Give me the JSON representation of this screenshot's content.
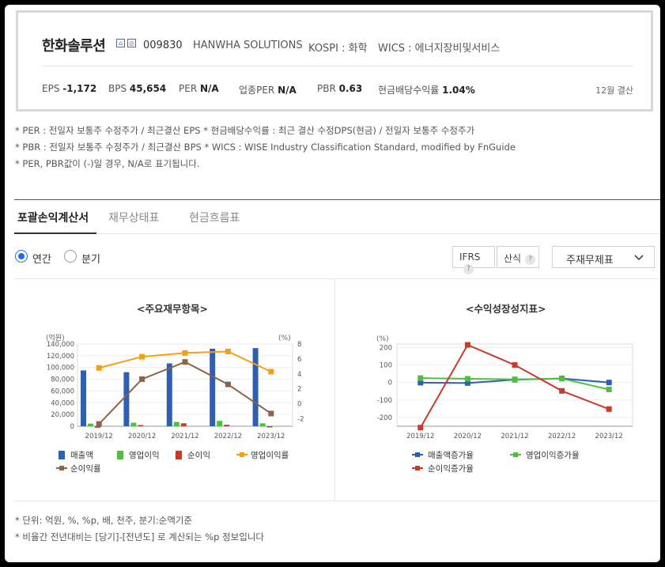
{
  "company": {
    "name": "한화솔루션",
    "code": "009830",
    "english_name": "HANWHA SOLUTIONS",
    "market": "KOSPI : 화학",
    "wics": "WICS : 에너지장비및서비스",
    "fiscal": "12월 결산"
  },
  "stats": [
    {
      "label": "EPS",
      "value": "-1,172"
    },
    {
      "label": "BPS",
      "value": "45,654"
    },
    {
      "label": "PER",
      "value": "N/A"
    },
    {
      "label": "업종PER",
      "value": "N/A"
    },
    {
      "label": "PBR",
      "value": "0.63"
    },
    {
      "label": "현금배당수익률",
      "value": "1.04%"
    }
  ],
  "notes": [
    "* PER : 전일자 보통주 수정주가 / 최근결산 EPS * 현금배당수익률 : 최근 결산 수정DPS(현금) / 전일자 보통주 수정주가",
    "* PBR : 전일자 보통주 수정주가 / 최근결산 BPS * WICS : WISE Industry Classification Standard, modified by FnGuide",
    "* PER, PBR값이 (-)일 경우, N/A로 표기됩니다."
  ],
  "tabs": [
    "포괄손익계산서",
    "재무상태표",
    "현금흐름표"
  ],
  "period": {
    "annual": "연간",
    "quarter": "분기"
  },
  "options": {
    "ifrs": "IFRS",
    "ifrs_help": "?",
    "calc": "산식",
    "calc_help": "?",
    "select": "주재무제표"
  },
  "footer": [
    "* 단위: 억원, %, %p, 배, 천주, 분기:순액기준",
    "* 비율간 전년대비는 [당기]-[전년도] 로 계산되는 %p 정보입니다"
  ],
  "chart_data": [
    {
      "type": "bar",
      "title": "<주요재무항목>",
      "categories": [
        "2019/12",
        "2020/12",
        "2021/12",
        "2022/12",
        "2023/12"
      ],
      "ylabel_left": "(억원)",
      "ylabel_right": "(%)",
      "ylim_left": [
        0,
        140000
      ],
      "yticks_left": [
        "0",
        "20,000",
        "40,000",
        "60,000",
        "80,000",
        "100,000",
        "120,000",
        "140,000"
      ],
      "ylim_right": [
        -3,
        8
      ],
      "yticks_right": [
        "-2",
        "0",
        "2",
        "4",
        "6",
        "8"
      ],
      "series": [
        {
          "name": "매출액",
          "type": "bar",
          "axis": "left",
          "color": "#2f5fb3",
          "values": [
            95000,
            92000,
            107000,
            132000,
            133000
          ]
        },
        {
          "name": "영업이익",
          "type": "bar",
          "axis": "left",
          "color": "#4fbf3f",
          "values": [
            4500,
            6000,
            7400,
            9200,
            5000
          ]
        },
        {
          "name": "순이익",
          "type": "bar",
          "axis": "left",
          "color": "#c83a2a",
          "values": [
            -2500,
            2000,
            5000,
            2500,
            -1300
          ]
        },
        {
          "name": "영업이익률",
          "type": "line",
          "axis": "right",
          "color": "#f5a011",
          "values": [
            4.8,
            6.3,
            6.8,
            7.0,
            4.3
          ]
        },
        {
          "name": "순이익률",
          "type": "line",
          "axis": "right",
          "color": "#8b6348",
          "values": [
            -2.7,
            3.3,
            5.6,
            2.6,
            -1.3
          ]
        }
      ],
      "grid": true,
      "legend": "bottom"
    },
    {
      "type": "line",
      "title": "<수익성장성지표>",
      "categories": [
        "2019/12",
        "2020/12",
        "2021/12",
        "2022/12",
        "2023/12"
      ],
      "ylabel": "(%)",
      "ylim": [
        -250,
        220
      ],
      "yticks": [
        "-200",
        "-100",
        "0",
        "100",
        "200"
      ],
      "series": [
        {
          "name": "매출액증가율",
          "color": "#2f5fb3",
          "values": [
            -1,
            -3,
            16,
            23,
            0
          ]
        },
        {
          "name": "영업이익증가율",
          "color": "#4fbf3f",
          "values": [
            25,
            21,
            18,
            22,
            -40
          ]
        },
        {
          "name": "순이익증가율",
          "color": "#c83a2a",
          "values": [
            -258,
            215,
            100,
            -48,
            -152
          ]
        }
      ],
      "grid": true,
      "legend": "bottom"
    }
  ]
}
